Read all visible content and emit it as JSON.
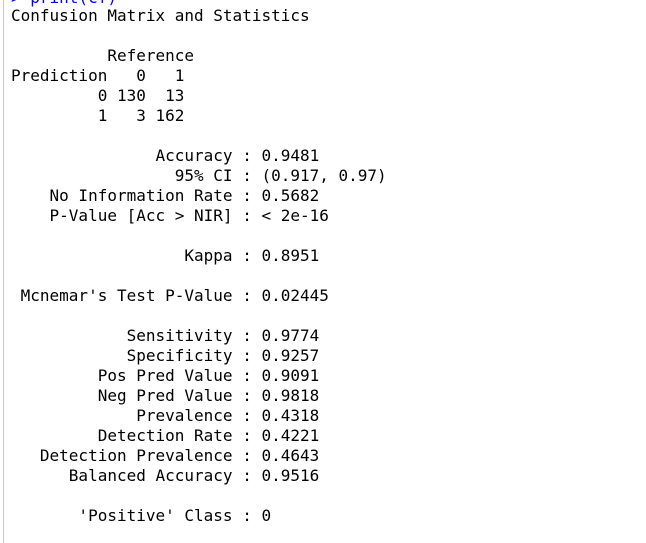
{
  "console": {
    "command_prompt": "> print(cf)",
    "colors": {
      "background": "#ffffff",
      "output_text": "#000000",
      "command_text": "#0000ff"
    },
    "output_lines": [
      "Confusion Matrix and Statistics",
      "",
      "          Reference",
      "Prediction   0   1",
      "         0 130  13",
      "         1   3 162",
      "",
      "               Accuracy : 0.9481",
      "                 95% CI : (0.917, 0.97)",
      "    No Information Rate : 0.5682",
      "    P-Value [Acc > NIR] : < 2e-16",
      "",
      "                  Kappa : 0.8951",
      "",
      " Mcnemar's Test P-Value : 0.02445",
      "",
      "            Sensitivity : 0.9774",
      "            Specificity : 0.9257",
      "         Pos Pred Value : 0.9091",
      "         Neg Pred Value : 0.9818",
      "             Prevalence : 0.4318",
      "         Detection Rate : 0.4221",
      "   Detection Prevalence : 0.4643",
      "      Balanced Accuracy : 0.9516",
      "",
      "       'Positive' Class : 0"
    ]
  }
}
